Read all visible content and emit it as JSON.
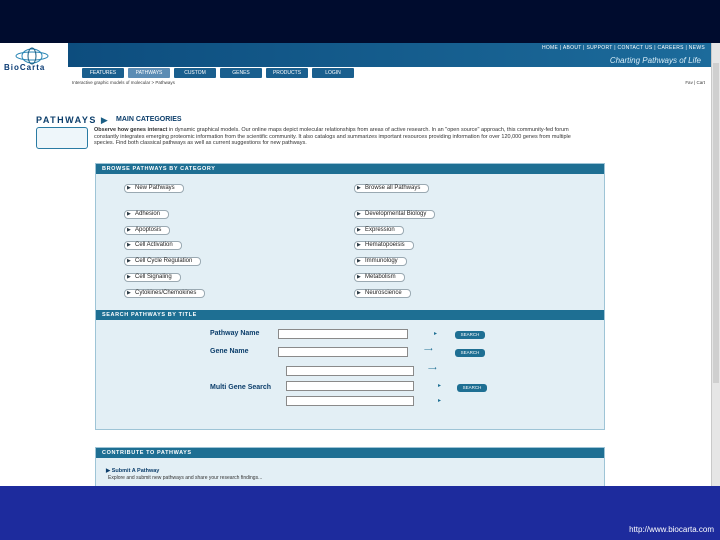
{
  "header": {
    "logo": "BioCarta",
    "top_links": "HOME | ABOUT | SUPPORT | CONTACT US | CAREERS | NEWS",
    "tagline": "Charting Pathways of Life",
    "nav": [
      "FEATURES",
      "PATHWAYS",
      "CUSTOM SERVICES",
      "GENES",
      "PRODUCTS",
      "LOGIN"
    ],
    "active_nav": "PATHWAYS",
    "subline": "Interactive graphic models of molecular > Pathways",
    "flags": "Fav | Cart"
  },
  "section": {
    "title": "PATHWAYS",
    "subtitle": "MAIN CATEGORIES",
    "intro_bold": "Observe how genes interact",
    "intro_rest": " in dynamic graphical models. Our online maps depict molecular relationships from areas of active research. In an \"open source\" approach, this community-fed forum constantly integrates emerging proteomic information from the scientific community. It also catalogs and summarizes important resources providing information for over 120,000 genes from multiple species. Find both classical pathways as well as current suggestions for new pathways."
  },
  "browse": {
    "header": "BROWSE PATHWAYS BY CATEGORY",
    "left": [
      "New Pathways",
      "Adhesion",
      "Apoptosis",
      "Cell Activation",
      "Cell Cycle Regulation",
      "Cell Signaling",
      "Cytokines/Chemokines"
    ],
    "right": [
      "Browse all Pathways",
      "Developmental Biology",
      "Expression",
      "Hematopoeisis",
      "Immunology",
      "Metabolism",
      "Neuroscience"
    ]
  },
  "search": {
    "header": "SEARCH PATHWAYS BY TITLE",
    "pathway_label": "Pathway Name",
    "gene_label": "Gene Name",
    "multi_label": "Multi Gene Search",
    "button": "SEARCH"
  },
  "contribute": {
    "header": "CONTRIBUTE TO PATHWAYS",
    "submit": "Submit A Pathway",
    "text": "Explore and submit new pathways and share your research findings..."
  },
  "footer": {
    "url": "http://www.biocarta.com"
  }
}
